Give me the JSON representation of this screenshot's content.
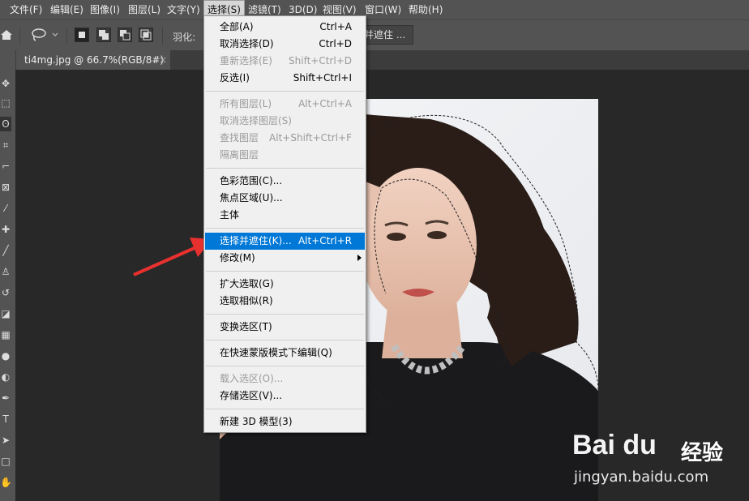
{
  "menubar": {
    "items": [
      "文件(F)",
      "编辑(E)",
      "图像(I)",
      "图层(L)",
      "文字(Y)",
      "选择(S)",
      "滤镜(T)",
      "3D(D)",
      "视图(V)",
      "窗口(W)",
      "帮助(H)"
    ],
    "active": "选择(S)"
  },
  "options": {
    "feather_label": "羽化:",
    "refine_partial": "并遮住 ..."
  },
  "document": {
    "tab_title": "ti4mg.jpg @ 66.7%(RGB/8#) *",
    "close_glyph": "×"
  },
  "select_menu": {
    "items": [
      {
        "label": "全部(A)",
        "shortcut": "Ctrl+A",
        "disabled": false
      },
      {
        "label": "取消选择(D)",
        "shortcut": "Ctrl+D",
        "disabled": false
      },
      {
        "label": "重新选择(E)",
        "shortcut": "Shift+Ctrl+D",
        "disabled": true
      },
      {
        "label": "反选(I)",
        "shortcut": "Shift+Ctrl+I",
        "disabled": false
      },
      {
        "label": "所有图层(L)",
        "shortcut": "Alt+Ctrl+A",
        "disabled": true
      },
      {
        "label": "取消选择图层(S)",
        "shortcut": "",
        "disabled": true
      },
      {
        "label": "查找图层",
        "shortcut": "Alt+Shift+Ctrl+F",
        "disabled": true
      },
      {
        "label": "隔离图层",
        "shortcut": "",
        "disabled": true
      },
      {
        "label": "色彩范围(C)...",
        "shortcut": "",
        "disabled": false
      },
      {
        "label": "焦点区域(U)...",
        "shortcut": "",
        "disabled": false
      },
      {
        "label": "主体",
        "shortcut": "",
        "disabled": false
      },
      {
        "label": "选择并遮住(K)...",
        "shortcut": "Alt+Ctrl+R",
        "disabled": false,
        "highlighted": true
      },
      {
        "label": "修改(M)",
        "shortcut": "",
        "disabled": false,
        "submenu": true
      },
      {
        "label": "扩大选取(G)",
        "shortcut": "",
        "disabled": false
      },
      {
        "label": "选取相似(R)",
        "shortcut": "",
        "disabled": false
      },
      {
        "label": "变换选区(T)",
        "shortcut": "",
        "disabled": false
      },
      {
        "label": "在快速蒙版模式下编辑(Q)",
        "shortcut": "",
        "disabled": false
      },
      {
        "label": "载入选区(O)...",
        "shortcut": "",
        "disabled": true
      },
      {
        "label": "存储选区(V)...",
        "shortcut": "",
        "disabled": false
      },
      {
        "label": "新建 3D 模型(3)",
        "shortcut": "",
        "disabled": false
      }
    ]
  },
  "watermark": {
    "logo": "Bai du",
    "cn": "经验",
    "url": "jingyan.baidu.com"
  },
  "colors": {
    "highlight": "#0078d7",
    "arrow": "#e8312f"
  }
}
